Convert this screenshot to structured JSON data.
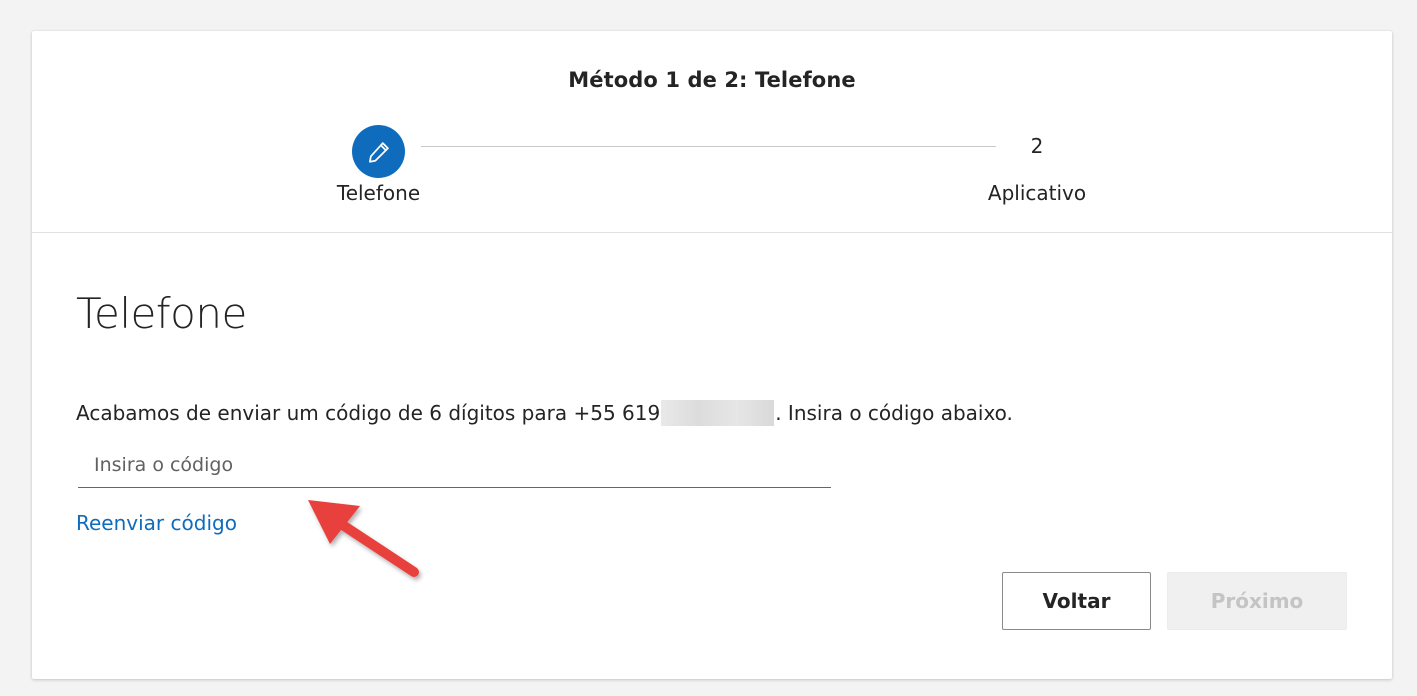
{
  "progress": {
    "title": "Método 1 de 2: Telefone",
    "step1": {
      "label": "Telefone",
      "icon": "pencil-icon"
    },
    "step2": {
      "number": "2",
      "label": "Aplicativo"
    }
  },
  "content": {
    "title": "Telefone",
    "instruction_prefix": "Acabamos de enviar um código de 6 dígitos para +55 619",
    "instruction_suffix": ". Insira o código abaixo.",
    "code_input": {
      "placeholder": "Insira o código",
      "value": ""
    },
    "resend_link": "Reenviar código"
  },
  "buttons": {
    "back": "Voltar",
    "next": "Próximo"
  },
  "colors": {
    "accent": "#0f6cbd",
    "annotation_arrow": "#e8403c",
    "disabled_text": "#c4c4c4"
  }
}
